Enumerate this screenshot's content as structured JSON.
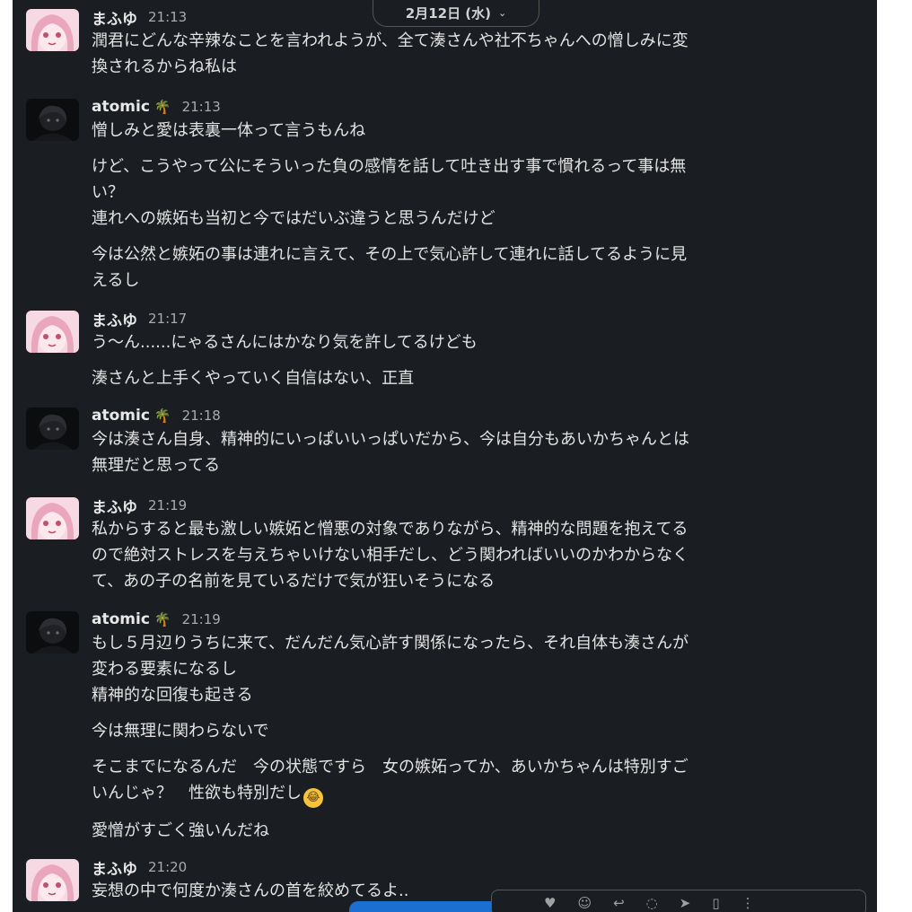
{
  "date_divider": {
    "label": "2月12日 (水)"
  },
  "messages": [
    {
      "author": "まふゆ",
      "time": "21:13",
      "avatar": "pink-anime-avatar",
      "paragraphs": [
        "潤君にどんな辛辣なことを言われようが、全て湊さんや社不ちゃんへの憎しみに変\n換されるからね私は"
      ]
    },
    {
      "author": "atomic",
      "badge": "🌴",
      "time": "21:13",
      "avatar": "dark-avatar",
      "paragraphs": [
        "憎しみと愛は表裏一体って言うもんね",
        "けど、こうやって公にそういった負の感情を話して吐き出す事で慣れるって事は無\nい？\n連れへの嫉妬も当初と今ではだいぶ違うと思うんだけど",
        "今は公然と嫉妬の事は連れに言えて、その上で気心許して連れに話してるように見\nえるし"
      ]
    },
    {
      "author": "まふゆ",
      "time": "21:17",
      "avatar": "pink-anime-avatar",
      "paragraphs": [
        "う〜ん......にゃるさんにはかなり気を許してるけども",
        "湊さんと上手くやっていく自信はない、正直"
      ]
    },
    {
      "author": "atomic",
      "badge": "🌴",
      "time": "21:18",
      "avatar": "dark-avatar",
      "paragraphs": [
        "今は湊さん自身、精神的にいっぱいいっぱいだから、今は自分もあいかちゃんとは\n無理だと思ってる"
      ]
    },
    {
      "author": "まふゆ",
      "time": "21:19",
      "avatar": "pink-anime-avatar",
      "paragraphs": [
        "私からすると最も激しい嫉妬と憎悪の対象でありながら、精神的な問題を抱えてる\nので絶対ストレスを与えちゃいけない相手だし、どう関わればいいのかわからなく\nて、あの子の名前を見ているだけで気が狂いそうになる"
      ]
    },
    {
      "author": "atomic",
      "badge": "🌴",
      "time": "21:19",
      "avatar": "dark-avatar",
      "paragraphs": [
        "もし５月辺りうちに来て、だんだん気心許す関係になったら、それ自体も湊さんが\n変わる要素になるし\n精神的な回復も起きる",
        "今は無理に関わらないで",
        "そこまでになるんだ　今の状態ですら　女の嫉妬ってか、あいかちゃんは特別すご\nいんじゃ？　性欲も特別だし",
        "愛憎がすごく強いんだね"
      ],
      "emoji_after_paragraph": 2,
      "emoji": "rolling-on-floor-laughing"
    },
    {
      "author": "まふゆ",
      "time": "21:20",
      "avatar": "pink-anime-avatar",
      "paragraphs": [
        "妄想の中で何度か湊さんの首を絞めてるよ.."
      ]
    }
  ],
  "hover_actions": [
    "react-icon",
    "emoji-icon",
    "reply-icon",
    "thread-icon",
    "forward-icon",
    "bookmark-icon",
    "more-icon"
  ]
}
